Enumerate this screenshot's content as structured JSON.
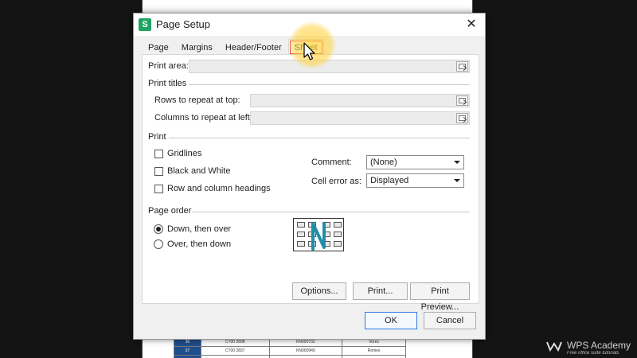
{
  "dialog": {
    "title": "Page Setup",
    "icon": "wps-spreadsheet-icon",
    "close": "✕"
  },
  "tabs": [
    {
      "label": "Page"
    },
    {
      "label": "Margins"
    },
    {
      "label": "Header/Footer"
    },
    {
      "label": "Sheet",
      "active": true
    }
  ],
  "sheet": {
    "print_area_label": "Print area:",
    "print_titles_group": "Print titles",
    "rows_repeat_label": "Rows to repeat at top:",
    "cols_repeat_label": "Columns to repeat at left:",
    "print_group": "Print",
    "gridlines_label": "Gridlines",
    "black_white_label": "Black and White",
    "row_col_headings_label": "Row and column headings",
    "comment_label": "Comment:",
    "comment_value": "(None)",
    "cell_error_label": "Cell error as:",
    "cell_error_value": "Displayed",
    "page_order_group": "Page order",
    "down_over_label": "Down, then over",
    "over_down_label": "Over, then down",
    "options_button": "Options...",
    "print_button": "Print...",
    "print_preview_button": "Print Preview..."
  },
  "footer": {
    "ok_button": "OK",
    "cancel_button": "Cancel"
  },
  "background_rows": [
    [
      "",
      "",
      "",
      ""
    ],
    [
      "36",
      "CT00 2898",
      "KN000732",
      "Vores"
    ],
    [
      "37",
      "CT00 2837",
      "KN000949",
      "Romes"
    ],
    [
      "",
      "",
      "",
      ""
    ]
  ],
  "watermark": {
    "title": "WPS Academy",
    "subtitle": "Free office suite tutorials"
  },
  "colors": {
    "accent_primary": "#2f7be0",
    "tab_highlight": "#e0333a",
    "cursor_halo": "#ffd23c",
    "app_icon": "#1fa463"
  }
}
